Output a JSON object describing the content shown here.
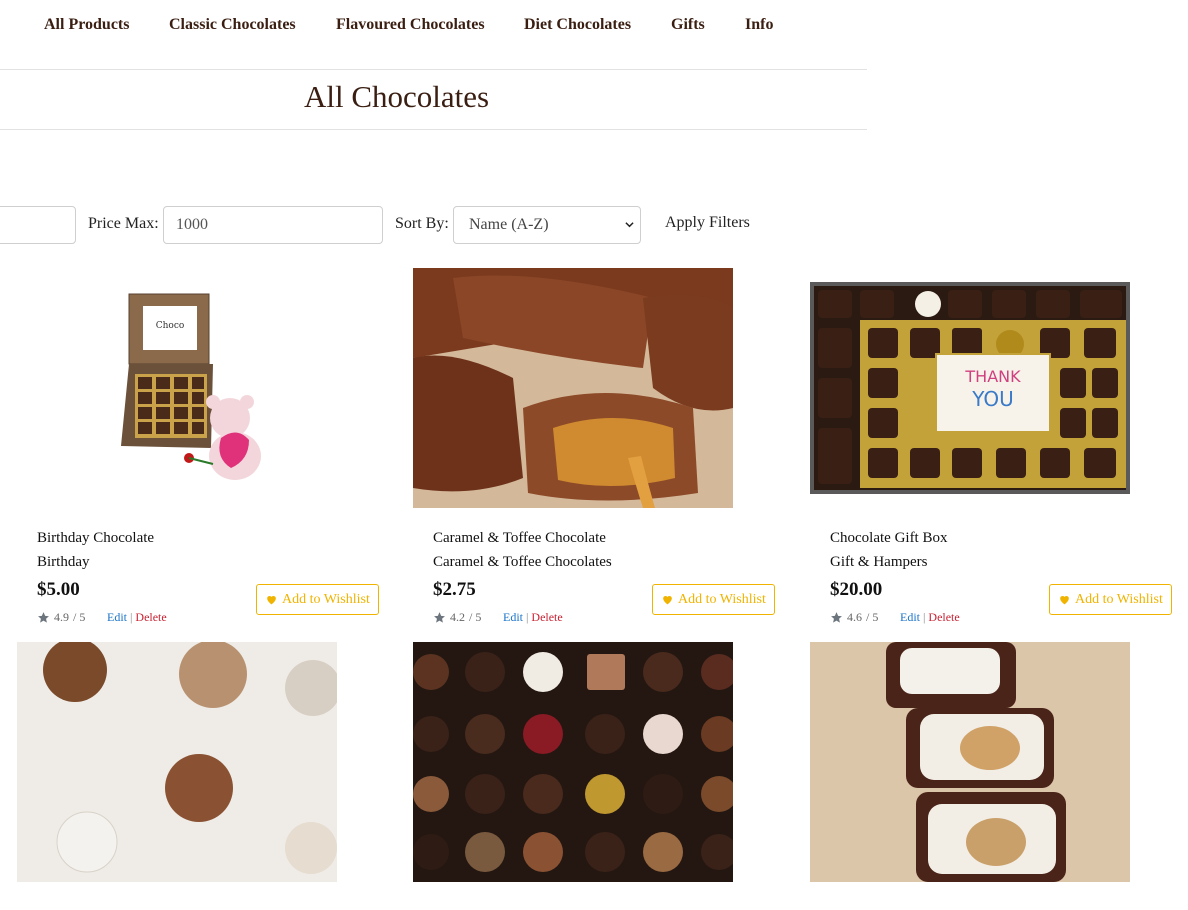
{
  "nav": {
    "items": [
      "All Products",
      "Classic Chocolates",
      "Flavoured Chocolates",
      "Diet Chocolates",
      "Gifts",
      "Info"
    ]
  },
  "page": {
    "title": "All Chocolates"
  },
  "filters": {
    "price_max_label": "Price Max:",
    "price_max_value": "1000",
    "sort_label": "Sort By:",
    "sort_selected": "Name (A-Z)",
    "apply_label": "Apply Filters"
  },
  "products": [
    {
      "name": "Birthday Chocolate",
      "category": "Birthday",
      "price": "$5.00",
      "rating": "4.9",
      "rating_suffix": "/ 5",
      "edit": "Edit",
      "sep": "|",
      "delete": "Delete",
      "wishlist": "Add to Wishlist"
    },
    {
      "name": "Caramel & Toffee Chocolate",
      "category": "Caramel & Toffee Chocolates",
      "price": "$2.75",
      "rating": "4.2",
      "rating_suffix": "/ 5",
      "edit": "Edit",
      "sep": "|",
      "delete": "Delete",
      "wishlist": "Add to Wishlist"
    },
    {
      "name": "Chocolate Gift Box",
      "category": "Gift & Hampers",
      "price": "$20.00",
      "rating": "4.6",
      "rating_suffix": "/ 5",
      "edit": "Edit",
      "sep": "|",
      "delete": "Delete",
      "wishlist": "Add to Wishlist"
    }
  ],
  "colors": {
    "brand": "#3a1e12",
    "wishlist": "#f0b400",
    "edit": "#1a73c8",
    "delete": "#c82333"
  }
}
